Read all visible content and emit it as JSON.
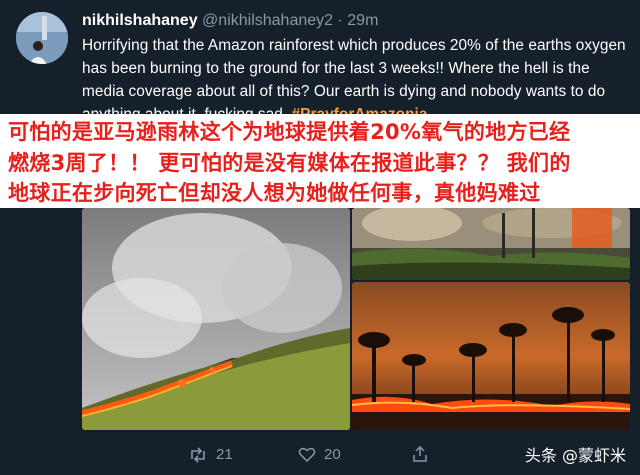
{
  "tweet": {
    "display_name": "nikhilshahaney",
    "handle": "@nikhilshahaney2",
    "separator": "·",
    "time": "29m",
    "text_main": "Horrifying that the Amazon rainforest which produces 20% of the earths oxygen has been burning to the ground for the last 3 weeks!! Where the hell is the media coverage about all of this? Our earth is dying and nobody wants to do anything about it, fucking sad.",
    "hashtag": "#PrayforAmazonia"
  },
  "overlay": {
    "line1": "可怕的是亚马逊雨林这个为地球提供着20%氧气的地方已经",
    "line2": "燃烧3周了！！ 更可怕的是没有媒体在报道此事？？ 我们的",
    "line3": "地球正在步向死亡但却没人想为她做任何事，真他妈难过"
  },
  "actions": {
    "retweets": "21",
    "likes": "20"
  },
  "watermark": {
    "text": "头条 @蒙虾米"
  },
  "colors": {
    "background": "#15202b",
    "overlay_text": "#e8201c",
    "hashtag": "#ff9b3a"
  }
}
